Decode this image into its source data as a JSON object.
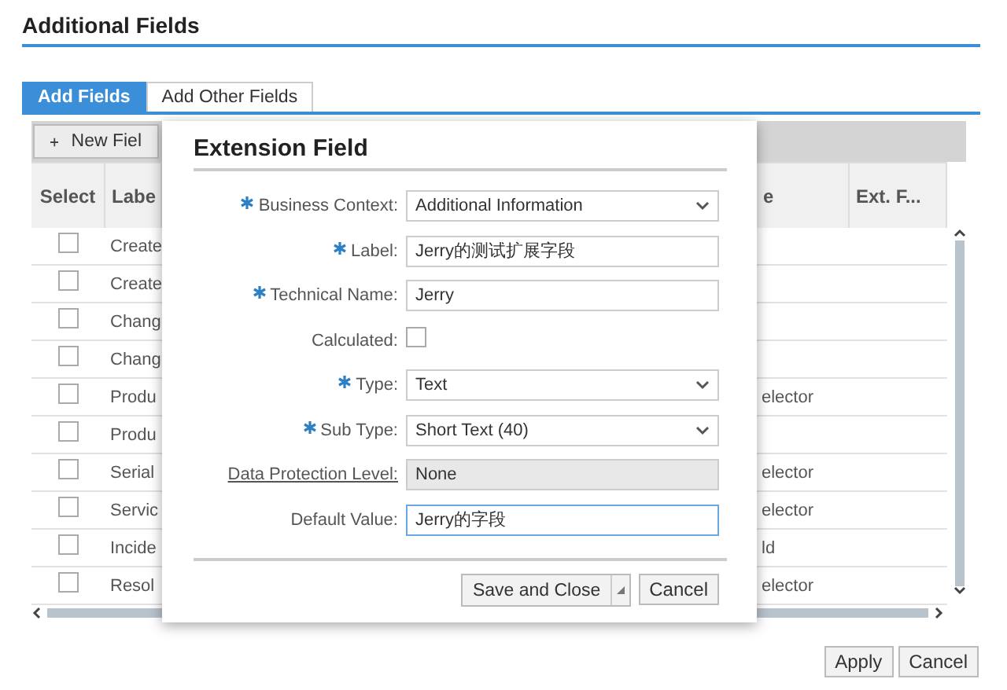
{
  "page_title": "Additional Fields",
  "tabs": [
    {
      "label": "Add Fields",
      "selected": true
    },
    {
      "label": "Add Other Fields",
      "selected": false
    }
  ],
  "toolbar": {
    "new_button": "New Fiel"
  },
  "table": {
    "columns": [
      "Select",
      "Labe",
      "e",
      "Ext. F..."
    ],
    "rows": [
      {
        "checked": false,
        "label": "Create",
        "column_3": ""
      },
      {
        "checked": false,
        "label": "Create",
        "column_3": ""
      },
      {
        "checked": false,
        "label": "Chang",
        "column_3": ""
      },
      {
        "checked": false,
        "label": "Chang",
        "column_3": ""
      },
      {
        "checked": false,
        "label": "Produ",
        "column_3": "elector"
      },
      {
        "checked": false,
        "label": "Produ",
        "column_3": ""
      },
      {
        "checked": false,
        "label": "Serial",
        "column_3": "elector"
      },
      {
        "checked": false,
        "label": "Servic",
        "column_3": "elector"
      },
      {
        "checked": false,
        "label": "Incide",
        "column_3": "ld"
      },
      {
        "checked": false,
        "label": "Resol",
        "column_3": "elector"
      }
    ]
  },
  "dialog": {
    "title": "Extension Field",
    "fields": [
      {
        "kind": "select",
        "label": "Business Context:",
        "required": true,
        "value": "Additional Information",
        "focused": false
      },
      {
        "kind": "text",
        "label": "Label:",
        "required": true,
        "value": "Jerry的测试扩展字段",
        "focused": false
      },
      {
        "kind": "text",
        "label": "Technical Name:",
        "required": true,
        "value": "Jerry",
        "focused": false
      },
      {
        "kind": "checkbox",
        "label": "Calculated:",
        "required": false,
        "checked": false
      },
      {
        "kind": "select",
        "label": "Type:",
        "required": true,
        "value": "Text",
        "focused": false
      },
      {
        "kind": "select",
        "label": "Sub Type:",
        "required": true,
        "value": "Short Text (40)",
        "focused": false
      },
      {
        "kind": "readonly",
        "label": "Data Protection Level:",
        "required": false,
        "link": true,
        "value": "None"
      },
      {
        "kind": "text",
        "label": "Default Value:",
        "required": false,
        "value": "Jerry的字段",
        "focused": true
      }
    ],
    "buttons": [
      "Save and Close",
      "Cancel"
    ]
  },
  "footer_buttons": [
    "Apply",
    "Cancel"
  ]
}
